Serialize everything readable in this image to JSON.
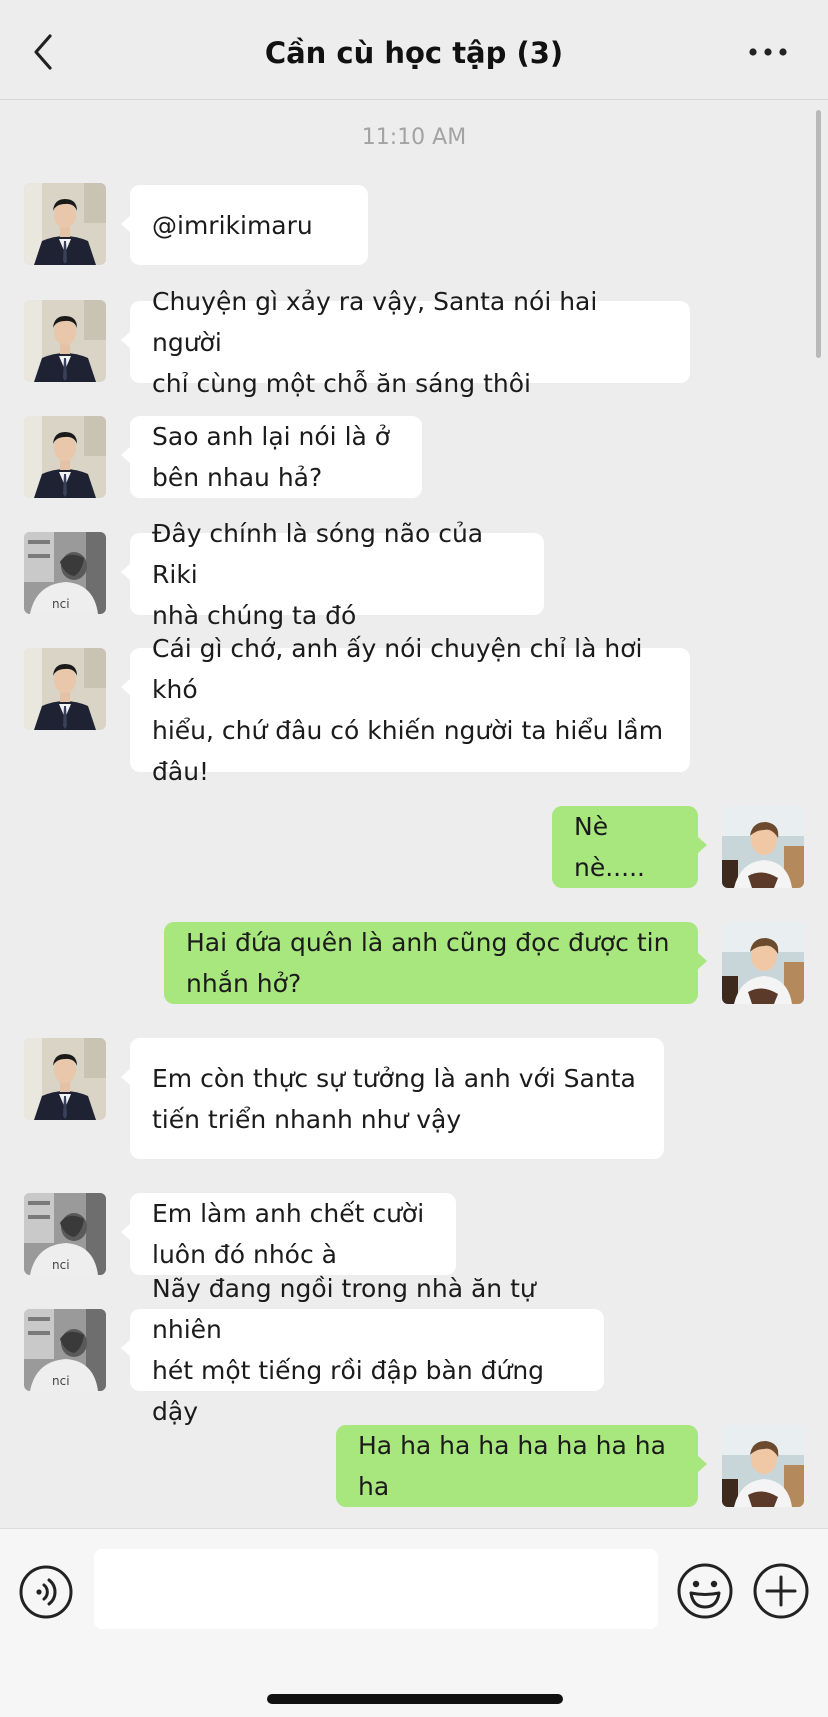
{
  "header": {
    "title": "Cần cù học tập (3)"
  },
  "timestamp": "11:10 AM",
  "messages": [
    {
      "side": "left",
      "avatar": "suit",
      "text": "@imrikimaru"
    },
    {
      "side": "left",
      "avatar": "suit",
      "text": "Chuyện gì xảy ra vậy, Santa nói hai người\nchỉ cùng một chỗ ăn sáng thôi"
    },
    {
      "side": "left",
      "avatar": "suit",
      "text": "Sao anh lại nói là ở\nbên nhau hả?"
    },
    {
      "side": "left",
      "avatar": "bw",
      "text": "Đây chính là sóng não của Riki\nnhà chúng ta đó"
    },
    {
      "side": "left",
      "avatar": "suit",
      "text": "Cái gì chớ, anh ấy nói chuyện chỉ là hơi khó\nhiểu, chứ đâu có khiến người ta hiểu lầm\nđâu!"
    },
    {
      "side": "right",
      "avatar": "color",
      "text": "Nè nè....."
    },
    {
      "side": "right",
      "avatar": "color",
      "text": "Hai đứa quên là anh cũng đọc được tin\nnhắn hở?"
    },
    {
      "side": "left",
      "avatar": "suit",
      "text": "Em còn thực sự tưởng là anh với Santa\ntiến triển nhanh như vậy"
    },
    {
      "side": "left",
      "avatar": "bw",
      "text": "Em làm anh chết cười\nluôn đó nhóc à"
    },
    {
      "side": "left",
      "avatar": "bw",
      "text": "Nãy đang ngồi trong nhà ăn tự nhiên\nhét một tiếng rồi đập bàn đứng dậy"
    },
    {
      "side": "right",
      "avatar": "color",
      "text": "Ha ha ha ha ha ha ha ha ha"
    }
  ],
  "composer": {
    "input_value": "",
    "icons": [
      "voice-icon",
      "emoji-icon",
      "plus-icon"
    ]
  },
  "header_icons": [
    "back-chevron-icon",
    "more-dots-icon"
  ],
  "colors": {
    "background": "#ededed",
    "incoming_bubble": "#ffffff",
    "outgoing_bubble": "#a8e67e"
  }
}
